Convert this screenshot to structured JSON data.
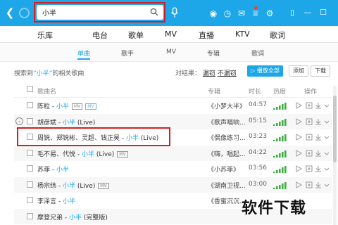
{
  "search": {
    "query": "小半"
  },
  "nav_tabs": [
    "乐库",
    "电台",
    "歌单",
    "MV",
    "直播",
    "KTV",
    "歌词"
  ],
  "sub_tabs": [
    "单曲",
    "歌手",
    "MV",
    "专辑",
    "歌词"
  ],
  "info": {
    "prefix": "搜索到",
    "keyword": "“小半”",
    "suffix": "的相关歌曲"
  },
  "compare": {
    "label": "对结果：",
    "option1": "漏窃",
    "option2": "不漏窃"
  },
  "buttons": {
    "play_all": "▷ 播放全部",
    "add": "添加",
    "download": "下载"
  },
  "table_headers": {
    "name": "歌曲名",
    "album": "专辑",
    "duration": "时长",
    "heat": "热度",
    "ops": "操作"
  },
  "rows": [
    {
      "title": "陈粒 - ",
      "artist": "小半",
      "tags": [
        "MV",
        "MV"
      ],
      "album": "《小梦大半》",
      "duration": "04:57"
    },
    {
      "title": "胡彦斌 - ",
      "artist": "小半",
      "extra": " (Live)",
      "album": "《歌声唱响...",
      "duration": "05:15"
    },
    {
      "title": "周锐、郑锐彬、灵超、钱正昊 - ",
      "artist": "小半",
      "extra": " (Live)",
      "album": "《偶像练习...",
      "duration": "03:23"
    },
    {
      "title": "毛不易、代悦 - ",
      "artist": "小半",
      "extra": " (Live)",
      "tags": [
        "MV"
      ],
      "album": "《嗨，唱起...",
      "duration": "04:22"
    },
    {
      "title": "苏菲 - ",
      "artist": "小半",
      "album": "《小苏菲》",
      "duration": "03:56"
    },
    {
      "title": "杨宗纬 - ",
      "artist": "小半",
      "extra": " (Live)",
      "tags": [
        "MV"
      ],
      "album": "《湖南卫视...",
      "duration": "03:00"
    },
    {
      "title": "李泽言 - ",
      "artist": "小半",
      "album": "《香蜜沉沉...",
      "duration": ""
    },
    {
      "title": "摩登兄弟 - ",
      "artist": "小半",
      "extra": " (完整版)",
      "album": "",
      "duration": ""
    }
  ],
  "watermark": "软件下载",
  "colors": {
    "accent": "#1ea7e8",
    "highlight": "#d42020",
    "heat": "#3cb043"
  }
}
